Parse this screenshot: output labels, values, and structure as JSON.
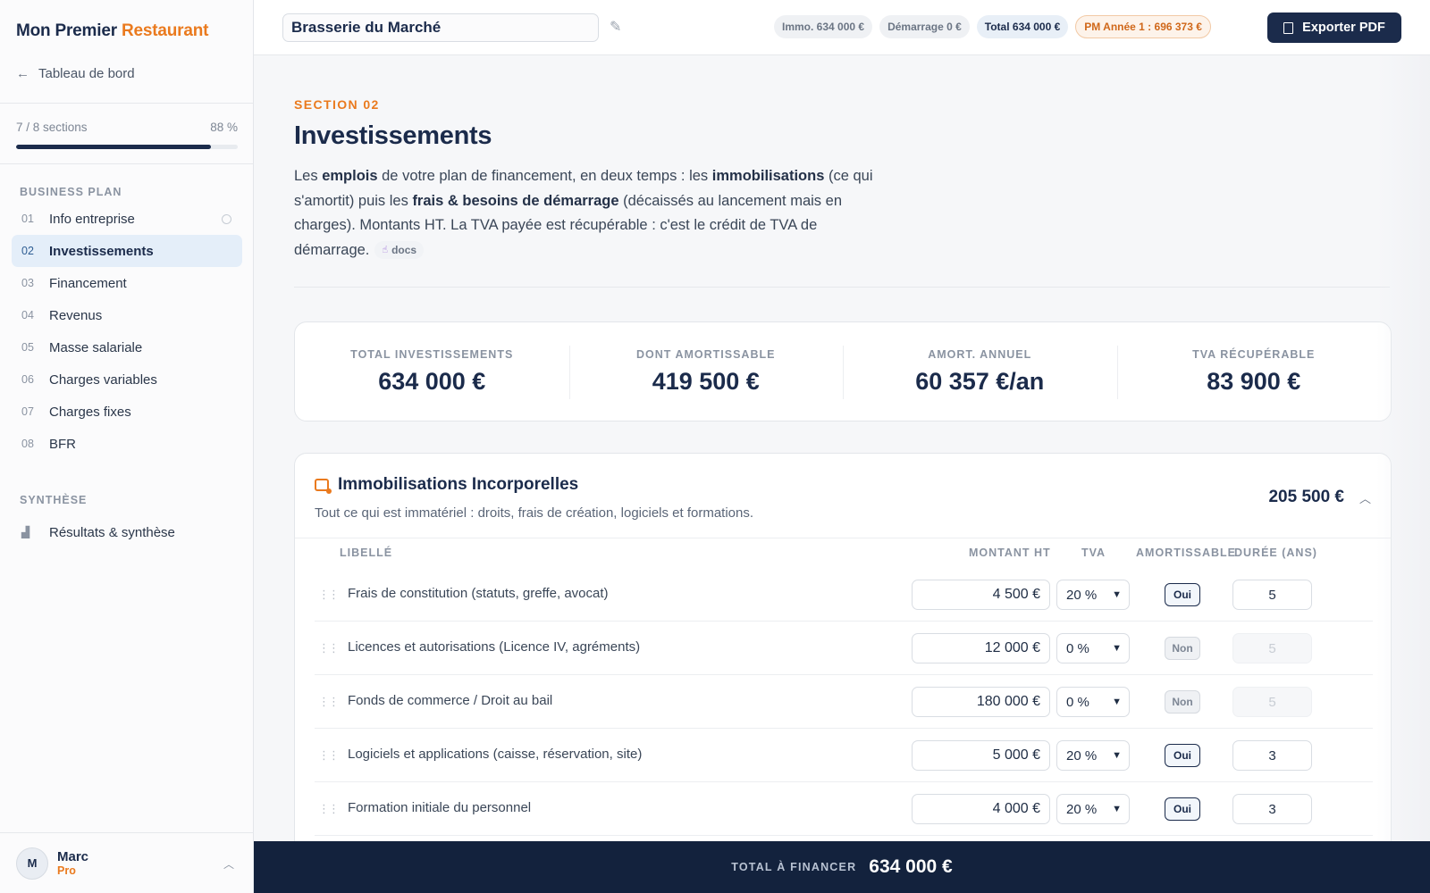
{
  "brand": {
    "part1": "Mon Premier",
    "part2": "Restaurant"
  },
  "back": {
    "icon": "arrow-left-icon",
    "label": "Tableau de bord"
  },
  "progress": {
    "sections": "7 / 8 sections",
    "percent_label": "88 %",
    "fraction": 0.88
  },
  "nav": {
    "group1": "BUSINESS PLAN",
    "items": [
      {
        "num": "01",
        "label": "Info entreprise"
      },
      {
        "num": "02",
        "label": "Investissements"
      },
      {
        "num": "03",
        "label": "Financement"
      },
      {
        "num": "04",
        "label": "Revenus"
      },
      {
        "num": "05",
        "label": "Masse salariale"
      },
      {
        "num": "06",
        "label": "Charges variables"
      },
      {
        "num": "07",
        "label": "Charges fixes"
      },
      {
        "num": "08",
        "label": "BFR"
      }
    ],
    "group2": "SYNTHÈSE",
    "synth": {
      "icon": "chart-icon",
      "label": "Résultats & synthèse"
    }
  },
  "user": {
    "initial": "M",
    "name": "Marc",
    "plan": "Pro"
  },
  "topbar": {
    "project_name": "Brasserie du Marché",
    "chips": {
      "immo": "Immo. 634 000 €",
      "demarrage": "Démarrage 0 €",
      "total": "Total 634 000 €",
      "pm": "PM Année 1 : 696 373 €"
    },
    "export_label": "Exporter PDF"
  },
  "page": {
    "section_tag": "SECTION 02",
    "title": "Investissements",
    "intro": {
      "t1": "Les ",
      "b1": "emplois",
      "t2": " de votre plan de financement, en deux temps : les ",
      "b2": "immobilisations",
      "t3": " (ce qui s'amortit) puis les ",
      "b3": "frais & besoins de démarrage",
      "t4": " (décaissés au lancement mais en charges). Montants HT. La TVA payée est récupérable : c'est le crédit de TVA de démarrage.",
      "docs": "docs"
    }
  },
  "kpis": [
    {
      "label": "TOTAL INVESTISSEMENTS",
      "value": "634 000 €"
    },
    {
      "label": "DONT AMORTISSABLE",
      "value": "419 500 €"
    },
    {
      "label": "AMORT. ANNUEL",
      "value": "60 357 €/an"
    },
    {
      "label": "TVA RÉCUPÉRABLE",
      "value": "83 900 €"
    }
  ],
  "card": {
    "title": "Immobilisations Incorporelles",
    "subtitle": "Tout ce qui est immatériel : droits, frais de création, logiciels et formations.",
    "total": "205 500 €",
    "headers": {
      "libelle": "LIBELLÉ",
      "montant": "MONTANT HT",
      "tva": "TVA",
      "amort": "AMORTISSABLE",
      "duree": "DURÉE (ANS)"
    },
    "rows": [
      {
        "label": "Frais de constitution (statuts, greffe, avocat)",
        "amount": "4 500 €",
        "tva": "20 %",
        "amort": "Oui",
        "duree": "5"
      },
      {
        "label": "Licences et autorisations (Licence IV, agréments)",
        "amount": "12 000 €",
        "tva": "0 %",
        "amort": "Non",
        "duree": "5"
      },
      {
        "label": "Fonds de commerce / Droit au bail",
        "amount": "180 000 €",
        "tva": "0 %",
        "amort": "Non",
        "duree": "5"
      },
      {
        "label": "Logiciels et applications (caisse, réservation, site)",
        "amount": "5 000 €",
        "tva": "20 %",
        "amort": "Oui",
        "duree": "3"
      },
      {
        "label": "Formation initiale du personnel",
        "amount": "4 000 €",
        "tva": "20 %",
        "amort": "Oui",
        "duree": "3"
      }
    ]
  },
  "bottom": {
    "label": "TOTAL À FINANCER",
    "value": "634 000 €"
  }
}
